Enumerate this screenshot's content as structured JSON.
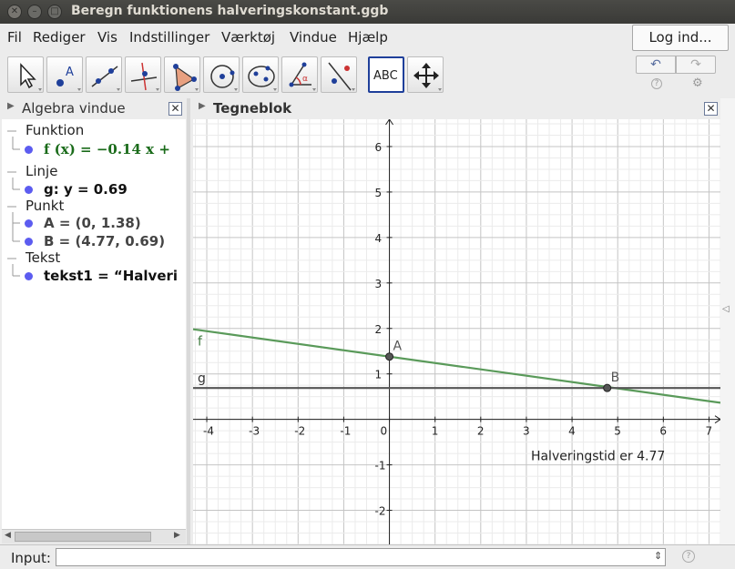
{
  "window": {
    "title": "Beregn funktionens halveringskonstant.ggb"
  },
  "menu": {
    "items": [
      "Fil",
      "Rediger",
      "Vis",
      "Indstillinger",
      "Værktøj",
      "Vindue",
      "Hjælp"
    ],
    "login": "Log ind..."
  },
  "toolbar": {
    "tools": [
      {
        "name": "move-tool-icon"
      },
      {
        "name": "point-tool-icon"
      },
      {
        "name": "line-tool-icon"
      },
      {
        "name": "perpendicular-line-tool-icon"
      },
      {
        "name": "polygon-tool-icon"
      },
      {
        "name": "circle-tool-icon"
      },
      {
        "name": "conic-tool-icon"
      },
      {
        "name": "angle-tool-icon"
      },
      {
        "name": "reflect-tool-icon"
      },
      {
        "name": "text-tool-icon",
        "label": "ABC",
        "selected": true
      },
      {
        "name": "move-graphics-tool-icon"
      }
    ],
    "undo": "↶",
    "redo": "↷",
    "help": "?",
    "settings": "⚙"
  },
  "algebra": {
    "title": "Algebra vindue",
    "categories": [
      {
        "label": "Funktion",
        "items": [
          {
            "text": "f (x)  =  −0.14 x +",
            "color": "#1a6b1a"
          }
        ]
      },
      {
        "label": "Linje",
        "items": [
          {
            "text": "g: y = 0.69",
            "color": "#111111"
          }
        ]
      },
      {
        "label": "Punkt",
        "items": [
          {
            "text": "A = (0,  1.38)",
            "color": "#444444"
          },
          {
            "text": "B = (4.77,  0.69)",
            "color": "#444444"
          }
        ]
      },
      {
        "label": "Tekst",
        "items": [
          {
            "text": "tekst1 = “Halveri",
            "color": "#111111"
          }
        ]
      }
    ]
  },
  "graphics": {
    "title": "Tegneblok",
    "text": "Halveringstid er 4.77",
    "labels": {
      "f": "f",
      "g": "g",
      "A": "A",
      "B": "B"
    }
  },
  "input": {
    "label": "Input:",
    "placeholder": ""
  },
  "chart_data": {
    "type": "line",
    "xlim": [
      -4.3,
      7.25
    ],
    "ylim": [
      -2.75,
      6.6
    ],
    "x_ticks": [
      -4,
      -3,
      -2,
      -1,
      0,
      1,
      2,
      3,
      4,
      5,
      6,
      7
    ],
    "y_ticks": [
      -2,
      -1,
      1,
      2,
      3,
      4,
      5,
      6
    ],
    "grid": true,
    "series": [
      {
        "name": "f",
        "slope": -0.14,
        "intercept": 1.38,
        "color": "#5a9a5a"
      },
      {
        "name": "g",
        "slope": 0,
        "intercept": 0.69,
        "color": "#555555"
      }
    ],
    "points": [
      {
        "name": "A",
        "x": 0,
        "y": 1.38
      },
      {
        "name": "B",
        "x": 4.77,
        "y": 0.69
      }
    ],
    "annotation": {
      "text": "Halveringstid er 4.77",
      "x": 3.1,
      "y": -0.9
    }
  }
}
